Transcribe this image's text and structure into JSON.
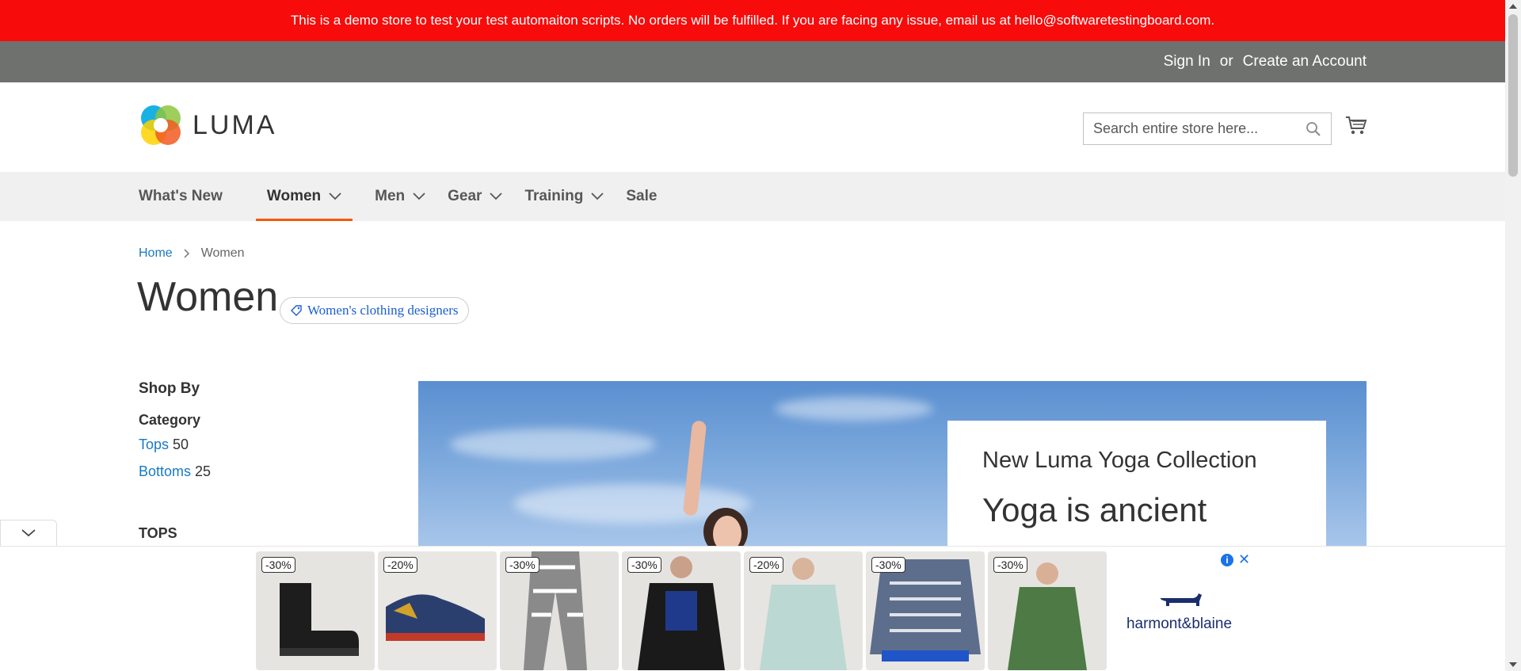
{
  "banner": {
    "text": "This is a demo store to test your test automaiton scripts. No orders will be fulfilled. If you are facing any issue, email us at hello@softwaretestingboard.com."
  },
  "header": {
    "sign_in": "Sign In",
    "or": "or",
    "create_account": "Create an Account"
  },
  "logo": {
    "text": "LUMA"
  },
  "search": {
    "placeholder": "Search entire store here..."
  },
  "nav": {
    "items": [
      {
        "label": "What's New",
        "has_dropdown": false,
        "active": false
      },
      {
        "label": "Women",
        "has_dropdown": true,
        "active": true
      },
      {
        "label": "Men",
        "has_dropdown": true,
        "active": false
      },
      {
        "label": "Gear",
        "has_dropdown": true,
        "active": false
      },
      {
        "label": "Training",
        "has_dropdown": true,
        "active": false
      },
      {
        "label": "Sale",
        "has_dropdown": false,
        "active": false
      }
    ]
  },
  "breadcrumb": {
    "home": "Home",
    "current": "Women"
  },
  "page": {
    "title": "Women",
    "tag": "Women's clothing designers"
  },
  "sidebar": {
    "title": "Shop By",
    "category_heading": "Category",
    "categories": [
      {
        "label": "Tops",
        "count": "50"
      },
      {
        "label": "Bottoms",
        "count": "25"
      }
    ],
    "section": "TOPS"
  },
  "hero": {
    "heading": "New Luma Yoga Collection",
    "subheading": "Yoga is ancient"
  },
  "ad": {
    "products": [
      {
        "discount": "-30%",
        "icon": "boot-icon",
        "color": "#1d1d1d"
      },
      {
        "discount": "-20%",
        "icon": "sneaker-icon",
        "color": "#2b3f6e"
      },
      {
        "discount": "-30%",
        "icon": "trousers-icon",
        "color": "#8a8a8a"
      },
      {
        "discount": "-30%",
        "icon": "sweater-icon",
        "color": "#1f3a8a"
      },
      {
        "discount": "-20%",
        "icon": "sweatshirt-icon",
        "color": "#bcd8d2"
      },
      {
        "discount": "-30%",
        "icon": "knit-sweater-icon",
        "color": "#5d6e8c"
      },
      {
        "discount": "-30%",
        "icon": "hoodie-icon",
        "color": "#4d7a45"
      }
    ],
    "brand": "harmont&blaine"
  },
  "colors": {
    "banner_bg": "#f70b0b",
    "header_bg": "#6e716e",
    "link": "#1979c3",
    "accent": "#ff5501"
  }
}
